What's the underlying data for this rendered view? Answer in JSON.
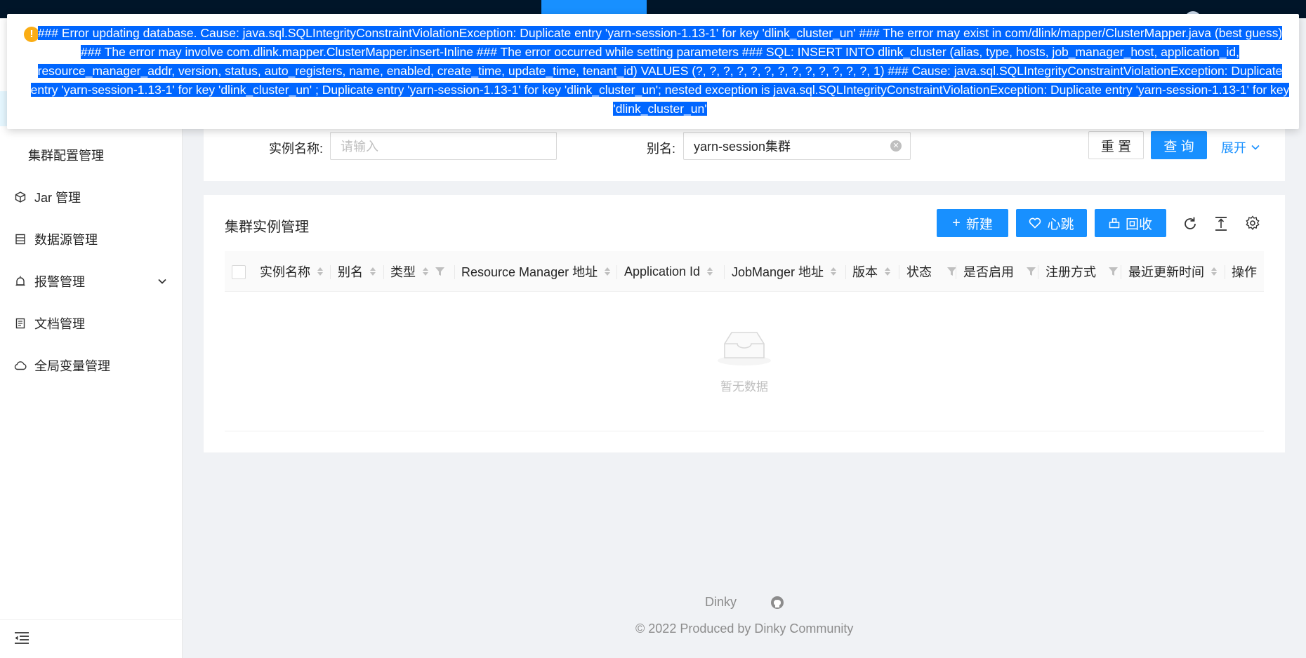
{
  "sidebar": {
    "items": [
      {
        "label": "集群配置管理",
        "icon": "none"
      },
      {
        "label": "Jar 管理",
        "icon": "cube-icon"
      },
      {
        "label": "数据源管理",
        "icon": "database-icon"
      },
      {
        "label": "报警管理",
        "icon": "alarm-icon"
      },
      {
        "label": "文档管理",
        "icon": "document-icon"
      },
      {
        "label": "全局变量管理",
        "icon": "cloud-icon"
      }
    ]
  },
  "search": {
    "instance_label": "实例名称:",
    "instance_placeholder": "请输入",
    "alias_label": "别名:",
    "alias_value": "yarn-session集群",
    "reset_label": "重 置",
    "query_label": "查 询",
    "expand_label": "展开"
  },
  "table": {
    "title": "集群实例管理",
    "toolbar": {
      "new_label": "新建",
      "heartbeat_label": "心跳",
      "recycle_label": "回收"
    },
    "columns": [
      "实例名称",
      "别名",
      "类型",
      "Resource Manager 地址",
      "Application Id",
      "JobManger 地址",
      "版本",
      "状态",
      "是否启用",
      "注册方式",
      "最近更新时间",
      "操作"
    ],
    "empty_text": "暂无数据"
  },
  "footer": {
    "brand": "Dinky",
    "copyright": "2022 Produced by Dinky Community"
  },
  "notification": {
    "message": "### Error updating database. Cause: java.sql.SQLIntegrityConstraintViolationException: Duplicate entry 'yarn-session-1.13-1' for key 'dlink_cluster_un' ### The error may exist in com/dlink/mapper/ClusterMapper.java (best guess) ### The error may involve com.dlink.mapper.ClusterMapper.insert-Inline ### The error occurred while setting parameters ### SQL: INSERT INTO dlink_cluster (alias, type, hosts, job_manager_host, application_id, resource_manager_addr, version, status, auto_registers, name, enabled, create_time, update_time, tenant_id) VALUES (?, ?, ?, ?, ?, ?, ?, ?, ?, ?, ?, ?, ?, 1) ### Cause: java.sql.SQLIntegrityConstraintViolationException: Duplicate entry 'yarn-session-1.13-1' for key 'dlink_cluster_un' ; Duplicate entry 'yarn-session-1.13-1' for key 'dlink_cluster_un'; nested exception is java.sql.SQLIntegrityConstraintViolationException: Duplicate entry 'yarn-session-1.13-1' for key 'dlink_cluster_un'",
    "level_icon": "warning-icon",
    "highlight_color": "#0066ff"
  }
}
